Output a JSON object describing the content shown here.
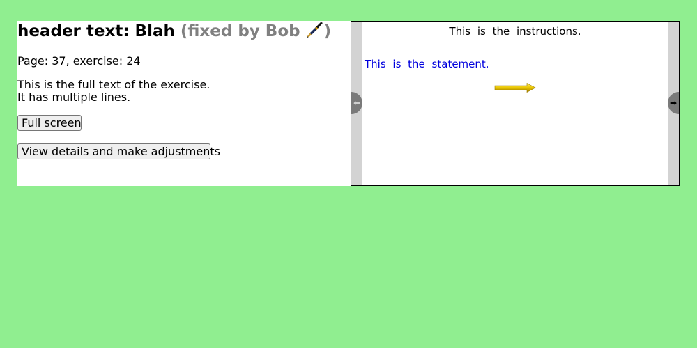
{
  "header": {
    "title": "header text: Blah",
    "fixed_prefix": "(fixed by Bob",
    "fixed_suffix": ")",
    "fixed_icon": "pen-icon",
    "fixed_color": "#808080"
  },
  "page_info": "Page: 37, exercise: 24",
  "exercise_text": {
    "lines": [
      "This is the full text of the exercise.",
      "It has multiple lines."
    ]
  },
  "buttons": {
    "full_screen": "Full screen",
    "details": "View details and make adjustments"
  },
  "preview": {
    "instructions": "This is the instructions.",
    "statement": "This is the statement.",
    "statement_color": "#0000dd",
    "arrow_icon": "arrow-right-icon",
    "prev_icon": "arrow-left-icon",
    "next_icon": "arrow-right-icon",
    "prev_glyph": "⬅",
    "next_glyph": "➡"
  },
  "colors": {
    "background": "#90ee90",
    "panel": "#ffffff",
    "preview_margin": "#d3d3d3",
    "nav_button": "#7a7a7a"
  }
}
